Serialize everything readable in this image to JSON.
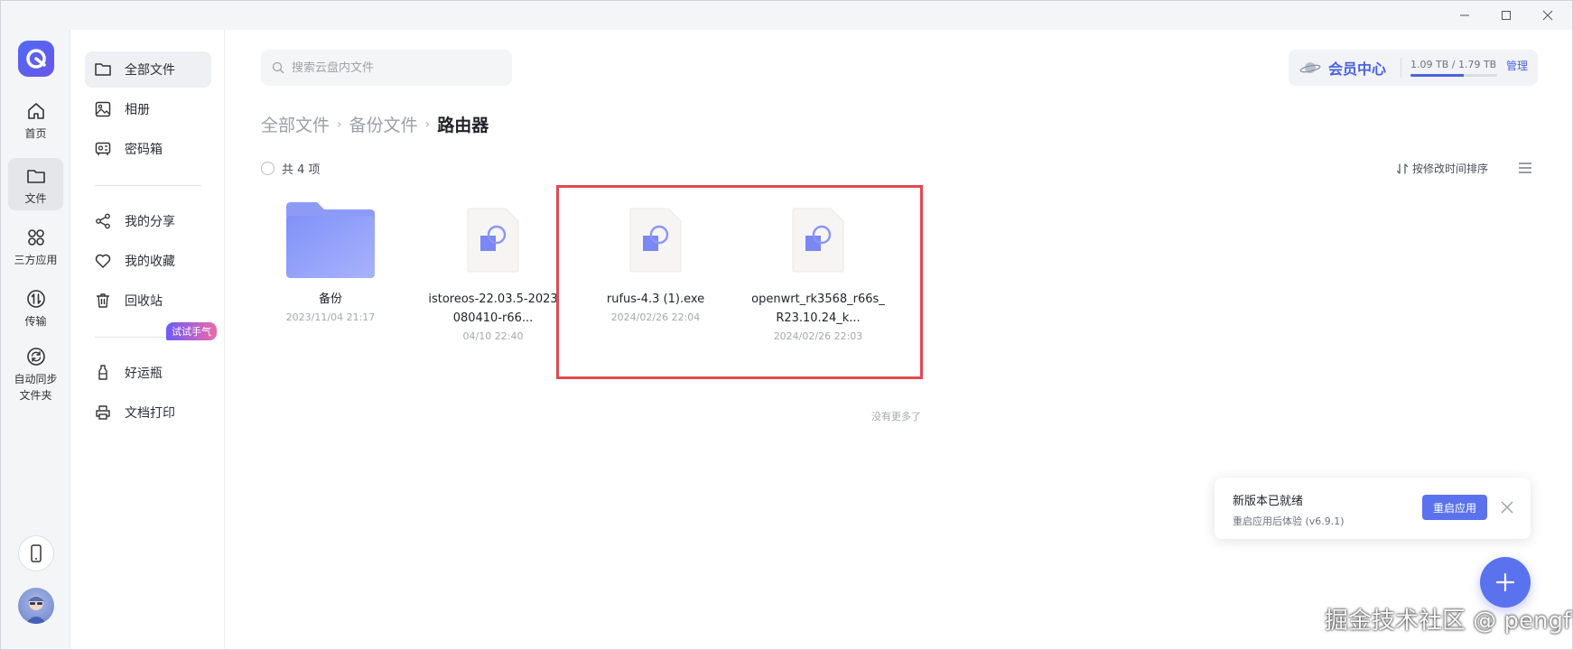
{
  "rail": {
    "items": [
      {
        "label": "首页",
        "icon": "home-icon"
      },
      {
        "label": "文件",
        "icon": "folder-icon"
      },
      {
        "label": "三方应用",
        "icon": "apps-icon"
      },
      {
        "label": "传输",
        "icon": "transfer-icon"
      },
      {
        "label": "自动同步\n文件夹",
        "line1": "自动同步",
        "line2": "文件夹",
        "icon": "sync-icon"
      }
    ]
  },
  "nav": {
    "items": [
      {
        "label": "全部文件",
        "icon": "folder-icon"
      },
      {
        "label": "相册",
        "icon": "photo-icon"
      },
      {
        "label": "密码箱",
        "icon": "safe-icon"
      },
      {
        "label": "我的分享",
        "icon": "share-icon"
      },
      {
        "label": "我的收藏",
        "icon": "heart-icon"
      },
      {
        "label": "回收站",
        "icon": "trash-icon"
      },
      {
        "label": "好运瓶",
        "icon": "bottle-icon"
      },
      {
        "label": "文档打印",
        "icon": "printer-icon"
      }
    ],
    "badge": "试试手气"
  },
  "search": {
    "placeholder": "搜索云盘内文件"
  },
  "member": {
    "label": "会员中心",
    "quota_text": "1.09 TB / 1.79 TB",
    "quota_used_fraction": 0.61,
    "manage": "管理"
  },
  "breadcrumb": {
    "items": [
      "全部文件",
      "备份文件"
    ],
    "current": "路由器"
  },
  "list": {
    "count": "共 4 项",
    "sort_label": "按修改时间排序",
    "files": [
      {
        "name": "备份",
        "time": "2023/11/04 21:17",
        "type": "folder"
      },
      {
        "name": "istoreos-22.03.5-2023080410-r66...",
        "time": "04/10 22:40",
        "type": "file"
      },
      {
        "name": "rufus-4.3 (1).exe",
        "time": "2024/02/26 22:04",
        "type": "file"
      },
      {
        "name": "openwrt_rk3568_r66s_R23.10.24_k...",
        "time": "2024/02/26 22:03",
        "type": "file"
      }
    ],
    "no_more": "没有更多了"
  },
  "toast": {
    "title": "新版本已就绪",
    "subtitle": "重启应用后体验 (v6.9.1)",
    "button": "重启应用"
  },
  "watermark": "掘金技术社区 @ pengf",
  "colors": {
    "accent": "#5b72ee",
    "highlight": "#e04a4f"
  }
}
